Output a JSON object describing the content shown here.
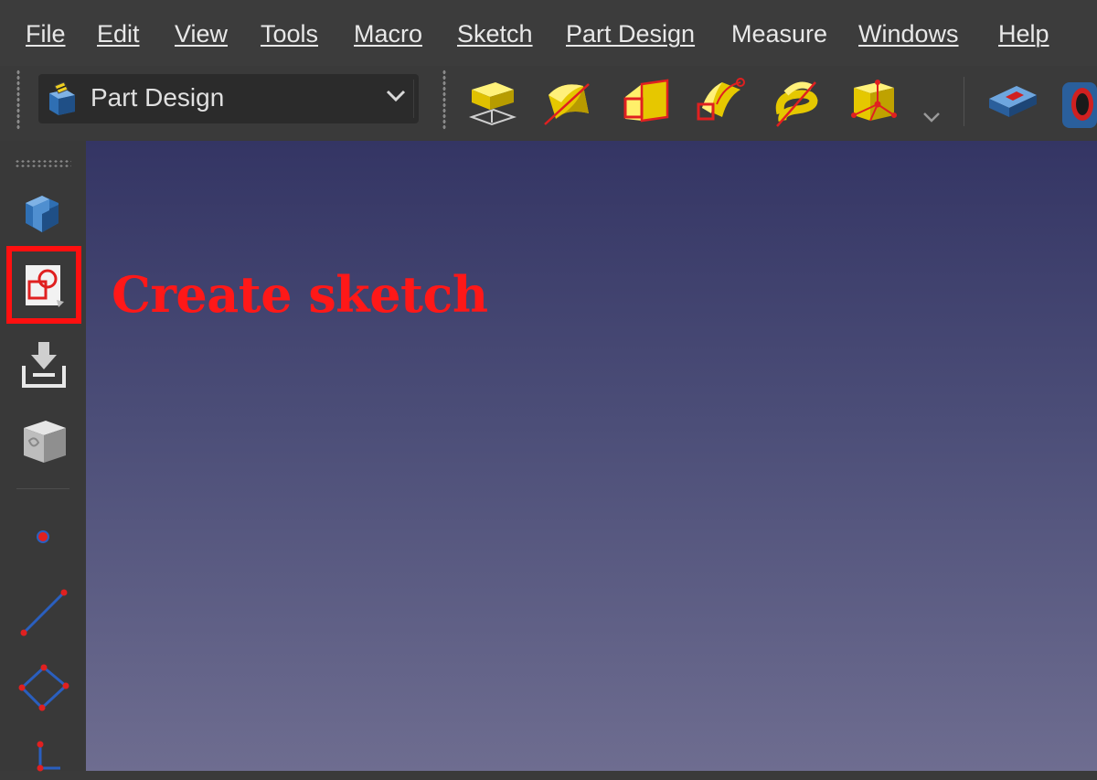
{
  "menubar": {
    "items": [
      {
        "label": "File"
      },
      {
        "label": "Edit"
      },
      {
        "label": "View"
      },
      {
        "label": "Tools"
      },
      {
        "label": "Macro"
      },
      {
        "label": "Sketch"
      },
      {
        "label": "Part Design"
      },
      {
        "label": "Measure"
      },
      {
        "label": "Windows"
      },
      {
        "label": "Help"
      }
    ]
  },
  "toolbar": {
    "workbench_selector": {
      "selected": "Part Design",
      "icon": "part-design-workbench-icon"
    },
    "tools": [
      {
        "icon": "pad-icon"
      },
      {
        "icon": "revolution-icon"
      },
      {
        "icon": "additive-loft-icon"
      },
      {
        "icon": "additive-pipe-icon"
      },
      {
        "icon": "additive-helix-icon"
      },
      {
        "icon": "additive-box-icon"
      },
      {
        "icon": "pocket-icon"
      },
      {
        "icon": "hole-icon"
      }
    ]
  },
  "left_toolbar": {
    "tools": [
      {
        "icon": "create-body-icon"
      },
      {
        "icon": "create-sketch-icon"
      },
      {
        "icon": "attach-sketch-icon"
      },
      {
        "icon": "shape-binder-icon"
      },
      {
        "icon": "sketch-point-icon"
      },
      {
        "icon": "sketch-line-icon"
      },
      {
        "icon": "sketch-rectangle-icon"
      },
      {
        "icon": "sketch-polyline-icon"
      }
    ]
  },
  "annotation": {
    "text": "Create sketch",
    "color": "#ff1818"
  },
  "colors": {
    "highlight": "#ff1010",
    "viewport_top": "#343564",
    "viewport_bottom": "#6e6d90"
  }
}
